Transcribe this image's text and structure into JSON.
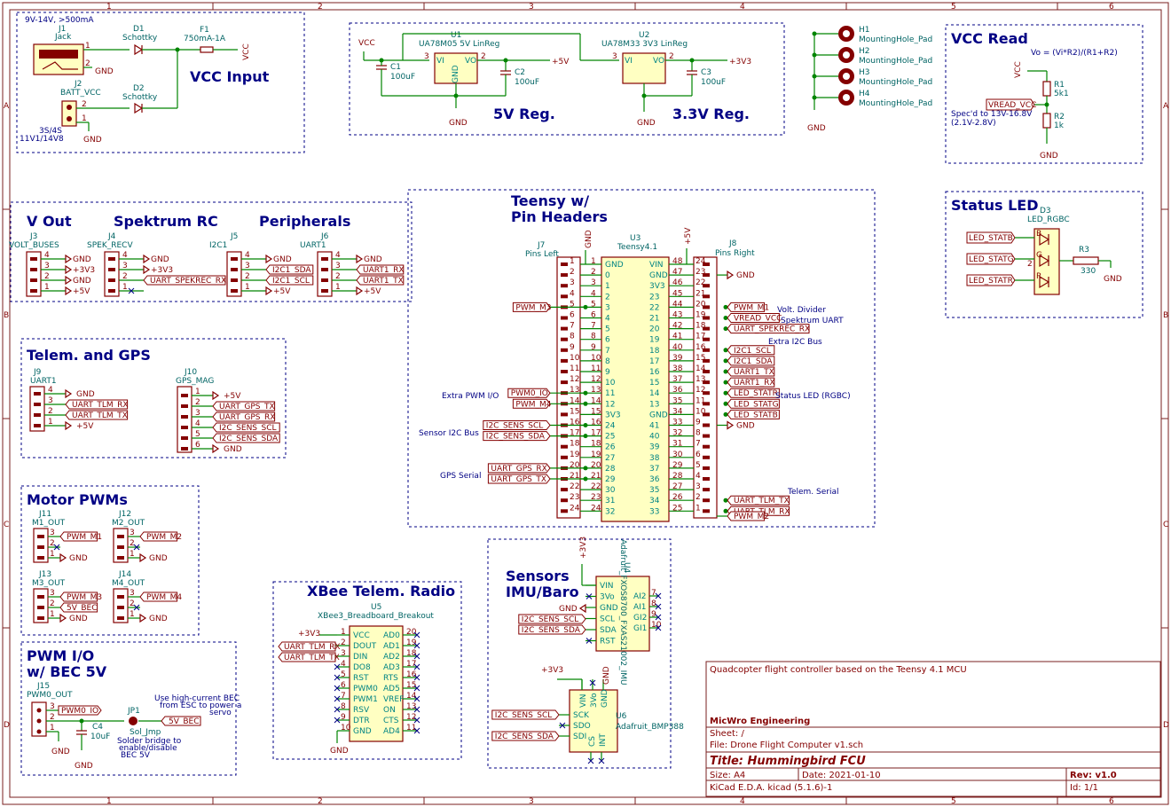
{
  "border": {
    "cols": [
      "1",
      "2",
      "3",
      "4",
      "5",
      "6"
    ],
    "rows": [
      "A",
      "B",
      "C",
      "D"
    ]
  },
  "headings": {
    "vcc_input": "VCC Input",
    "reg5": "5V Reg.",
    "reg33": "3.3V Reg.",
    "vcc_read": "VCC Read",
    "vout": "V Out",
    "spektrum": "Spektrum RC",
    "peripherals": "Peripherals",
    "teensy1": "Teensy w/",
    "teensy2": "Pin Headers",
    "status_led": "Status LED",
    "telem_gps": "Telem. and GPS",
    "motor": "Motor PWMs",
    "pwmio1": "PWM I/O",
    "pwmio2": "w/ BEC 5V",
    "xbee": "XBee Telem. Radio",
    "sensors1": "Sensors",
    "sensors2": "IMU/Baro"
  },
  "vcc_input": {
    "supply": "9V-14V, >500mA",
    "j1": "J1",
    "j1v": "Jack",
    "j2": "J2",
    "j2v": "BATT_VCC",
    "batt": "3S/4S",
    "batt2": "11V1/14V8",
    "d1": "D1",
    "d1v": "Schottky",
    "d2": "D2",
    "d2v": "Schottky",
    "f1": "F1",
    "f1v": "750mA-1A",
    "vcc": "VCC",
    "gnd": "GND"
  },
  "regs": {
    "vcc": "VCC",
    "u1": "U1",
    "u1v": "UA78M05 5V LinReg",
    "u2": "U2",
    "u2v": "UA78M33 3V3 LinReg",
    "c1": "C1",
    "c1v": "100uF",
    "c2": "C2",
    "c2v": "100uF",
    "c3": "C3",
    "c3v": "100uF",
    "p5": "+5V",
    "p33": "+3V3",
    "gnd": "GND",
    "vi": "VI",
    "vo": "VO",
    "g": "GND"
  },
  "mounting": {
    "holes": [
      {
        "ref": "H1",
        "val": "MountingHole_Pad"
      },
      {
        "ref": "H2",
        "val": "MountingHole_Pad"
      },
      {
        "ref": "H3",
        "val": "MountingHole_Pad"
      },
      {
        "ref": "H4",
        "val": "MountingHole_Pad"
      }
    ],
    "gnd": "GND"
  },
  "vccread": {
    "formula": "Vo = (Vi*R2)/(R1+R2)",
    "vcc": "VCC",
    "r1": "R1",
    "r1v": "5k1",
    "r2": "R2",
    "r2v": "1k",
    "label": "VREAD_VCC",
    "spec1": "Spec'd to 13V-16.8V",
    "spec2": "(2.1V-2.8V)",
    "gnd": "GND"
  },
  "vout": {
    "ref": "J3",
    "val": "VOLT_BUSES",
    "nets": [
      "GND",
      "+3V3",
      "GND",
      "+5V"
    ]
  },
  "spek": {
    "ref": "J4",
    "val": "SPEK_RECV",
    "nets": [
      "GND",
      "+3V3",
      "UART_SPEKREC_RX",
      ""
    ]
  },
  "j5": {
    "ref": "J5",
    "val": "I2C1",
    "nets": [
      "GND",
      "I2C1_SDA",
      "I2C1_SCL",
      "+5V"
    ]
  },
  "j6": {
    "ref": "J6",
    "val": "UART1",
    "nets": [
      "GND",
      "UART1_RX",
      "UART1_TX",
      "+5V"
    ]
  },
  "teensy": {
    "j7": "J7",
    "j7v": "Pins Left",
    "j8": "J8",
    "j8v": "Pins Right",
    "u3": "U3",
    "u3v": "Teensy4.1",
    "gnd": "GND",
    "p5": "+5V",
    "left_names": [
      "GND",
      "0",
      "1",
      "2",
      "3",
      "4",
      "5",
      "6",
      "7",
      "8",
      "9",
      "10",
      "11",
      "12",
      "3V3",
      "24",
      "25",
      "26",
      "27",
      "28",
      "29",
      "30",
      "31",
      "32"
    ],
    "right_names": [
      "VIN",
      "GND",
      "3V3",
      "23",
      "22",
      "21",
      "20",
      "19",
      "18",
      "17",
      "16",
      "15",
      "14",
      "13",
      "GND",
      "41",
      "40",
      "39",
      "38",
      "37",
      "36",
      "35",
      "34",
      "33"
    ],
    "left_pins": [
      "1",
      "2",
      "3",
      "4",
      "5",
      "6",
      "7",
      "8",
      "9",
      "10",
      "11",
      "12",
      "13",
      "14",
      "15",
      "16",
      "17",
      "18",
      "19",
      "20",
      "21",
      "22",
      "23",
      "24"
    ],
    "right_pins": [
      "48",
      "47",
      "46",
      "45",
      "44",
      "43",
      "42",
      "41",
      "40",
      "39",
      "38",
      "37",
      "36",
      "35",
      "34",
      "33",
      "32",
      "31",
      "30",
      "29",
      "28",
      "27",
      "26",
      "25"
    ],
    "right_hdr": [
      "24",
      "23",
      "22",
      "21",
      "20",
      "19",
      "18",
      "17",
      "16",
      "15",
      "14",
      "13",
      "12",
      "11",
      "10",
      "9",
      "8",
      "7",
      "6",
      "5",
      "4",
      "3",
      "2",
      "1"
    ],
    "left_labels": {
      "pwm_m3": "PWM_M3",
      "pwm0_io": "PWM0_IO",
      "pwm_m4": "PWM_M4",
      "i2c_sens_scl": "I2C_SENS_SCL",
      "i2c_sens_sda": "I2C_SENS_SDA",
      "uart_gps_rx": "UART_GPS_RX",
      "uart_gps_tx": "UART_GPS_TX"
    },
    "left_notes": {
      "pwm": "Extra PWM I/O",
      "sens": "Sensor I2C Bus",
      "gps": "GPS Serial"
    },
    "right_labels": {
      "pwm_m1": "PWM_M1",
      "vread": "VREAD_VCC",
      "spek": "UART_SPEKREC_RX",
      "i2c1_scl": "I2C1_SCL",
      "i2c1_sda": "I2C1_SDA",
      "u1tx": "UART1_TX",
      "u1rx": "UART1_RX",
      "ledr": "LED_STATR",
      "ledg": "LED_STATG",
      "ledb": "LED_STATB",
      "tlm_tx": "UART_TLM_TX",
      "tlm_rx": "UART_TLM_RX",
      "pwm_m2": "PWM_M2"
    },
    "right_notes": {
      "vd": "Volt. Divider",
      "sp": "Spektrum UART",
      "i2c": "Extra I2C Bus",
      "led": "Status LED (RGBC)",
      "tel": "Telem. Serial"
    }
  },
  "status_led": {
    "ref": "D3",
    "val": "LED_RGBC",
    "r3": "R3",
    "r3v": "330",
    "b": "LED_STATB",
    "g": "LED_STATG",
    "r": "LED_STATR",
    "gnd": "GND"
  },
  "telem": {
    "j9": "J9",
    "j9v": "UART1",
    "j9nets": [
      "GND",
      "UART_TLM_RX",
      "UART_TLM_TX",
      "+5V"
    ],
    "j10": "J10",
    "j10v": "GPS_MAG",
    "j10nets": [
      "+5V",
      "UART_GPS_TX",
      "UART_GPS_RX",
      "I2C_SENS_SCL",
      "I2C_SENS_SDA",
      "GND"
    ]
  },
  "motor": {
    "j11": "J11",
    "j11v": "M1_OUT",
    "m1": "PWM_M1",
    "j12": "J12",
    "j12v": "M2_OUT",
    "m2": "PWM_M2",
    "j13": "J13",
    "j13v": "M3_OUT",
    "m3": "PWM_M3",
    "bec": "5V_BEC",
    "j14": "J14",
    "j14v": "M4_OUT",
    "m4": "PWM_M4",
    "gnd": "GND"
  },
  "pwmio": {
    "j15": "J15",
    "j15v": "PWM0_OUT",
    "pwm0": "PWM0_IO",
    "c4": "C4",
    "c4v": "10uF",
    "jp1": "JP1",
    "jp1v": "Sol_Jmp",
    "bec": "5V_BEC",
    "note1": "Use high-current BEC",
    "note2": "from ESC to power a",
    "note3": "servo",
    "note4": "Solder bridge to",
    "note5": "enable/disable",
    "note6": "BEC 5V",
    "gnd": "GND"
  },
  "xbee": {
    "ref": "U5",
    "val": "XBee3_Breadboard_Breakout",
    "p33": "+3V3",
    "rx": "UART_TLM_RX",
    "tx": "UART_TLM_TX",
    "left": [
      "VCC",
      "DOUT",
      "DIN",
      "DO8",
      "RST",
      "PWM0",
      "PWM1",
      "RSV",
      "DTR",
      "GND"
    ],
    "right": [
      "AD0",
      "AD1",
      "AD2",
      "AD3",
      "RTS",
      "AD5",
      "VREF",
      "ON",
      "CTS",
      "AD4"
    ],
    "lpins": [
      "1",
      "2",
      "3",
      "4",
      "5",
      "6",
      "7",
      "8",
      "9",
      "10"
    ],
    "rpins": [
      "20",
      "19",
      "18",
      "17",
      "16",
      "15",
      "14",
      "13",
      "12",
      "11"
    ],
    "gnd": "GND"
  },
  "sensors": {
    "u4": "U4",
    "u4v": "Adafruit_FXOS8700_FXAS21002_IMU",
    "u4pins": [
      "VIN",
      "3Vo",
      "GND",
      "SCL",
      "SDA",
      "RST"
    ],
    "u4r": [
      "AI2",
      "AI1",
      "GI2",
      "GI1"
    ],
    "u4rp": [
      "7",
      "8",
      "9",
      "10"
    ],
    "p33": "+3V3",
    "gnd": "GND",
    "scl": "I2C_SENS_SCL",
    "sda": "I2C_SENS_SDA",
    "u6": "U6",
    "u6v": "Adafruit_BMP388",
    "u6pins": [
      "SCK",
      "SDO",
      "SDI",
      "CS",
      "INT",
      "VIN",
      "3Vo",
      "GND"
    ]
  },
  "title_block": {
    "desc": "Quadcopter flight controller based on the Teensy 4.1 MCU",
    "company": "MicWro Engineering",
    "sheet": "Sheet: /",
    "file": "File: Drone Flight Computer v1.sch",
    "title": "Title: Hummingbird FCU",
    "size": "Size: A4",
    "date": "Date: 2021-01-10",
    "rev": "Rev: v1.0",
    "kicad": "KiCad E.D.A.  kicad (5.1.6)-1",
    "id": "Id: 1/1"
  }
}
